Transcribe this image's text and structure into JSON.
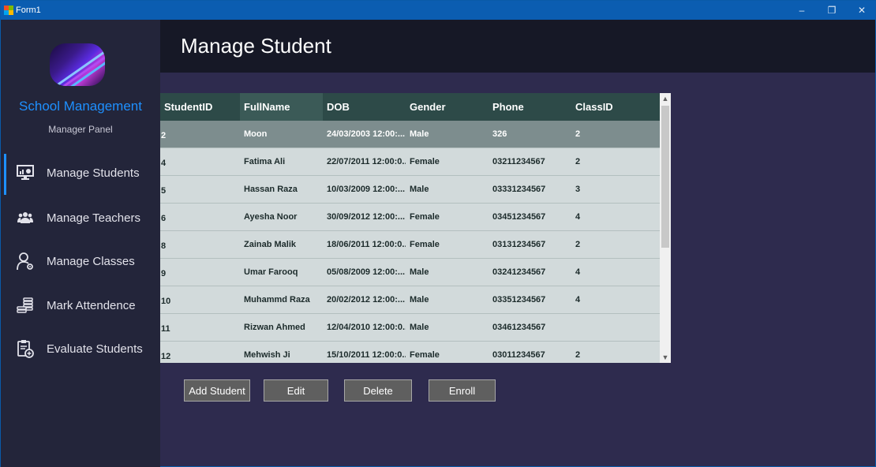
{
  "window": {
    "title": "Form1",
    "minimize": "–",
    "restore": "❐",
    "close": "✕"
  },
  "sidebar": {
    "brand": "School Management",
    "subtitle": "Manager Panel",
    "items": [
      {
        "label": "Manage Students",
        "icon": "monitor-chart-icon",
        "active": true
      },
      {
        "label": "Manage Teachers",
        "icon": "users-icon",
        "active": false
      },
      {
        "label": "Manage Classes",
        "icon": "user-gear-icon",
        "active": false
      },
      {
        "label": "Mark Attendence",
        "icon": "coins-stack-icon",
        "active": false
      },
      {
        "label": "Evaluate Students",
        "icon": "clipboard-add-icon",
        "active": false
      }
    ]
  },
  "header": {
    "title": "Manage Student"
  },
  "grid": {
    "columns": [
      "StudentID",
      "FullName",
      "DOB",
      "Gender",
      "Phone",
      "ClassID"
    ],
    "rows": [
      [
        "2",
        "Moon",
        "24/03/2003 12:00:...",
        "Male",
        "326",
        "2"
      ],
      [
        "4",
        "Fatima Ali",
        "22/07/2011 12:00:0...",
        "Female",
        "03211234567",
        "2"
      ],
      [
        "5",
        "Hassan Raza",
        "10/03/2009 12:00:...",
        "Male",
        "03331234567",
        "3"
      ],
      [
        "6",
        "Ayesha Noor",
        "30/09/2012 12:00:...",
        "Female",
        "03451234567",
        "4"
      ],
      [
        "8",
        "Zainab Malik",
        "18/06/2011 12:00:0...",
        "Female",
        "03131234567",
        "2"
      ],
      [
        "9",
        "Umar Farooq",
        "05/08/2009 12:00:...",
        "Male",
        "03241234567",
        "4"
      ],
      [
        "10",
        "Muhammd Raza",
        "20/02/2012 12:00:...",
        "Male",
        "03351234567",
        "4"
      ],
      [
        "11",
        "Rizwan Ahmed",
        "12/04/2010 12:00:0...",
        "Male",
        "03461234567",
        ""
      ],
      [
        "12",
        "Mehwish Ji",
        "15/10/2011 12:00:0...",
        "Female",
        "03011234567",
        "2"
      ]
    ],
    "selected_row": 0
  },
  "buttons": {
    "add": "Add Student",
    "edit": "Edit",
    "delete": "Delete",
    "enroll": "Enroll"
  },
  "colors": {
    "accent": "#1e90ff",
    "titlebar": "#0b5db1",
    "sidebar": "#23253a",
    "content": "#2e2b4e",
    "grid_header": "#2d4a48"
  }
}
